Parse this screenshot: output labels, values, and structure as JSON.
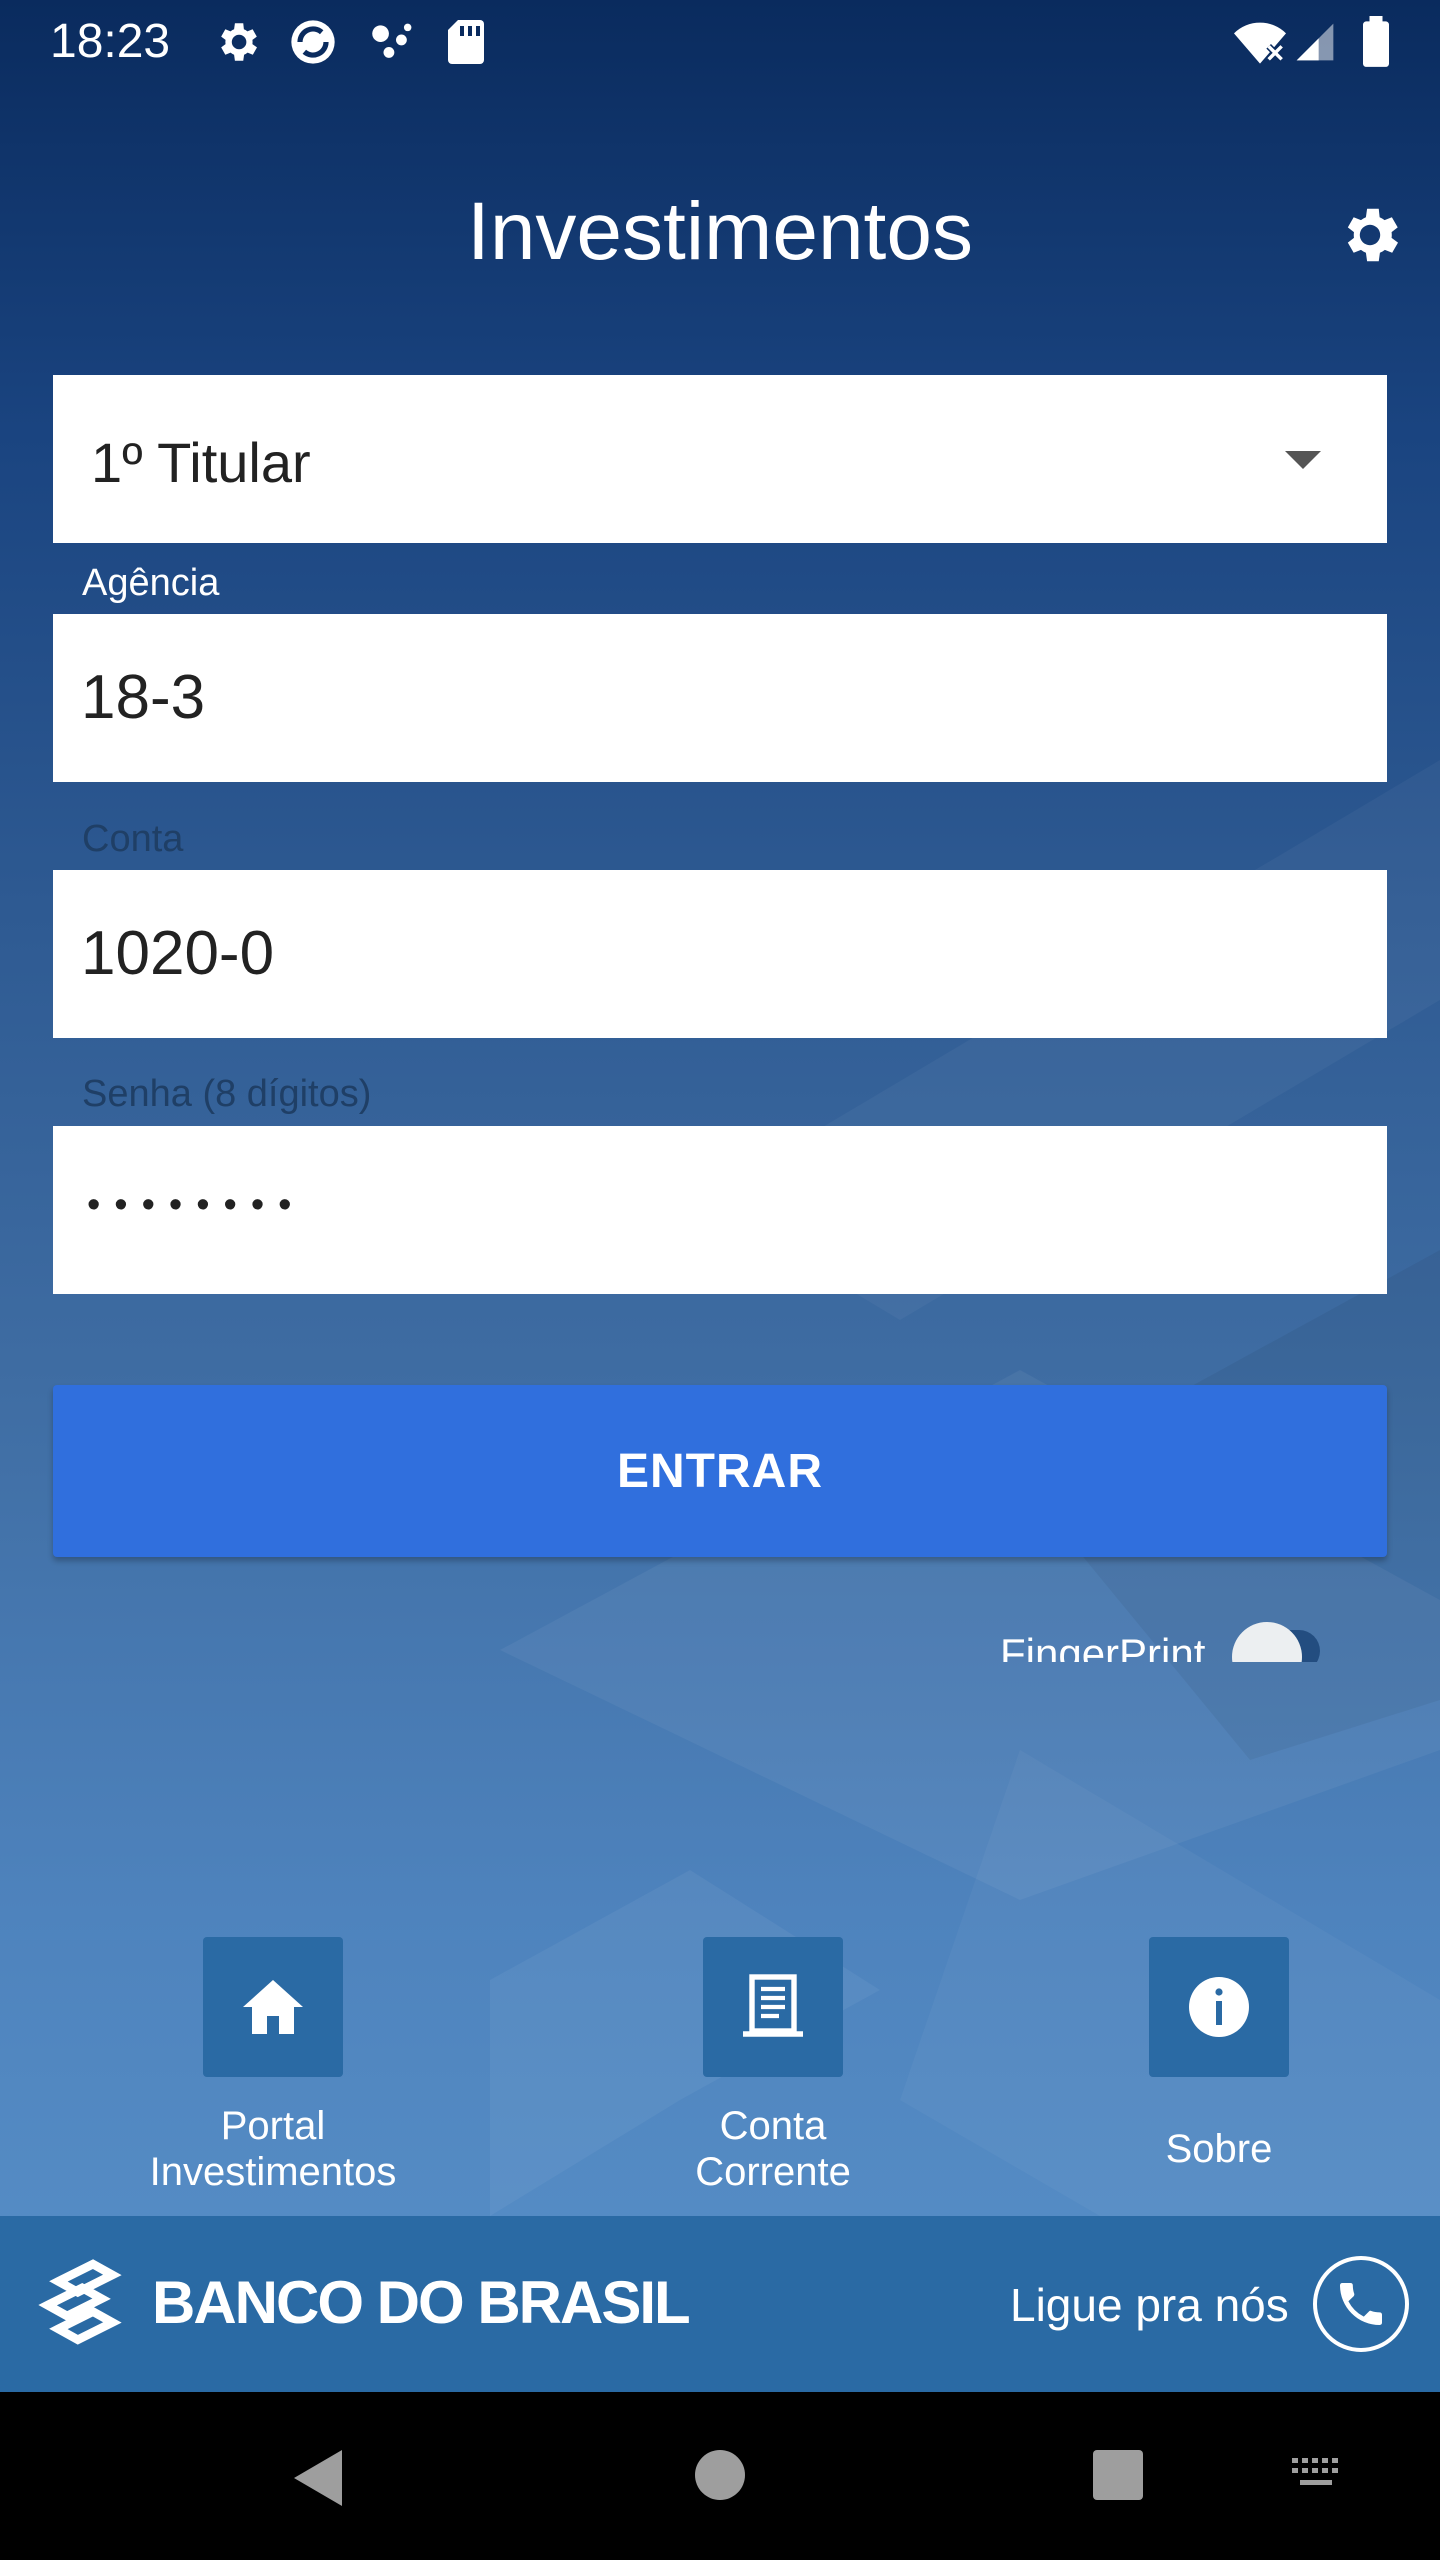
{
  "status_bar": {
    "time": "18:23",
    "icons": [
      "settings-icon",
      "sync-icon",
      "assistant-icon",
      "sd-card-icon",
      "wifi-off-icon",
      "signal-icon",
      "battery-icon"
    ]
  },
  "header": {
    "title": "Investimentos",
    "settings_icon": "gear-icon"
  },
  "form": {
    "titular_select": {
      "selected": "1º Titular"
    },
    "agencia": {
      "label": "Agência",
      "value": "18-3"
    },
    "conta": {
      "label": "Conta",
      "value": "1020-0"
    },
    "senha": {
      "label": "Senha (8 dígitos)",
      "value": "••••••••"
    },
    "enter_button": "ENTRAR",
    "fingerprint": {
      "label": "FingerPrint",
      "enabled": false
    }
  },
  "quick_links": [
    {
      "label_line1": "Portal",
      "label_line2": "Investimentos",
      "icon": "home-icon"
    },
    {
      "label_line1": "Conta",
      "label_line2": "Corrente",
      "icon": "statement-icon"
    },
    {
      "label_line1": "Sobre",
      "label_line2": "",
      "icon": "info-icon"
    }
  ],
  "footer": {
    "brand": "BANCO DO BRASIL",
    "call_label": "Ligue pra nós",
    "call_icon": "phone-icon"
  },
  "colors": {
    "background_top": "#0a2b5e",
    "background_bottom": "#5890c8",
    "button_blue": "#306fdd",
    "footer_blue": "#2a6aa4",
    "label_light": "#ffffff",
    "label_dim": "#1f3f66"
  },
  "nav_bar": [
    "back-icon",
    "home-circle-icon",
    "recents-icon",
    "keyboard-icon"
  ]
}
